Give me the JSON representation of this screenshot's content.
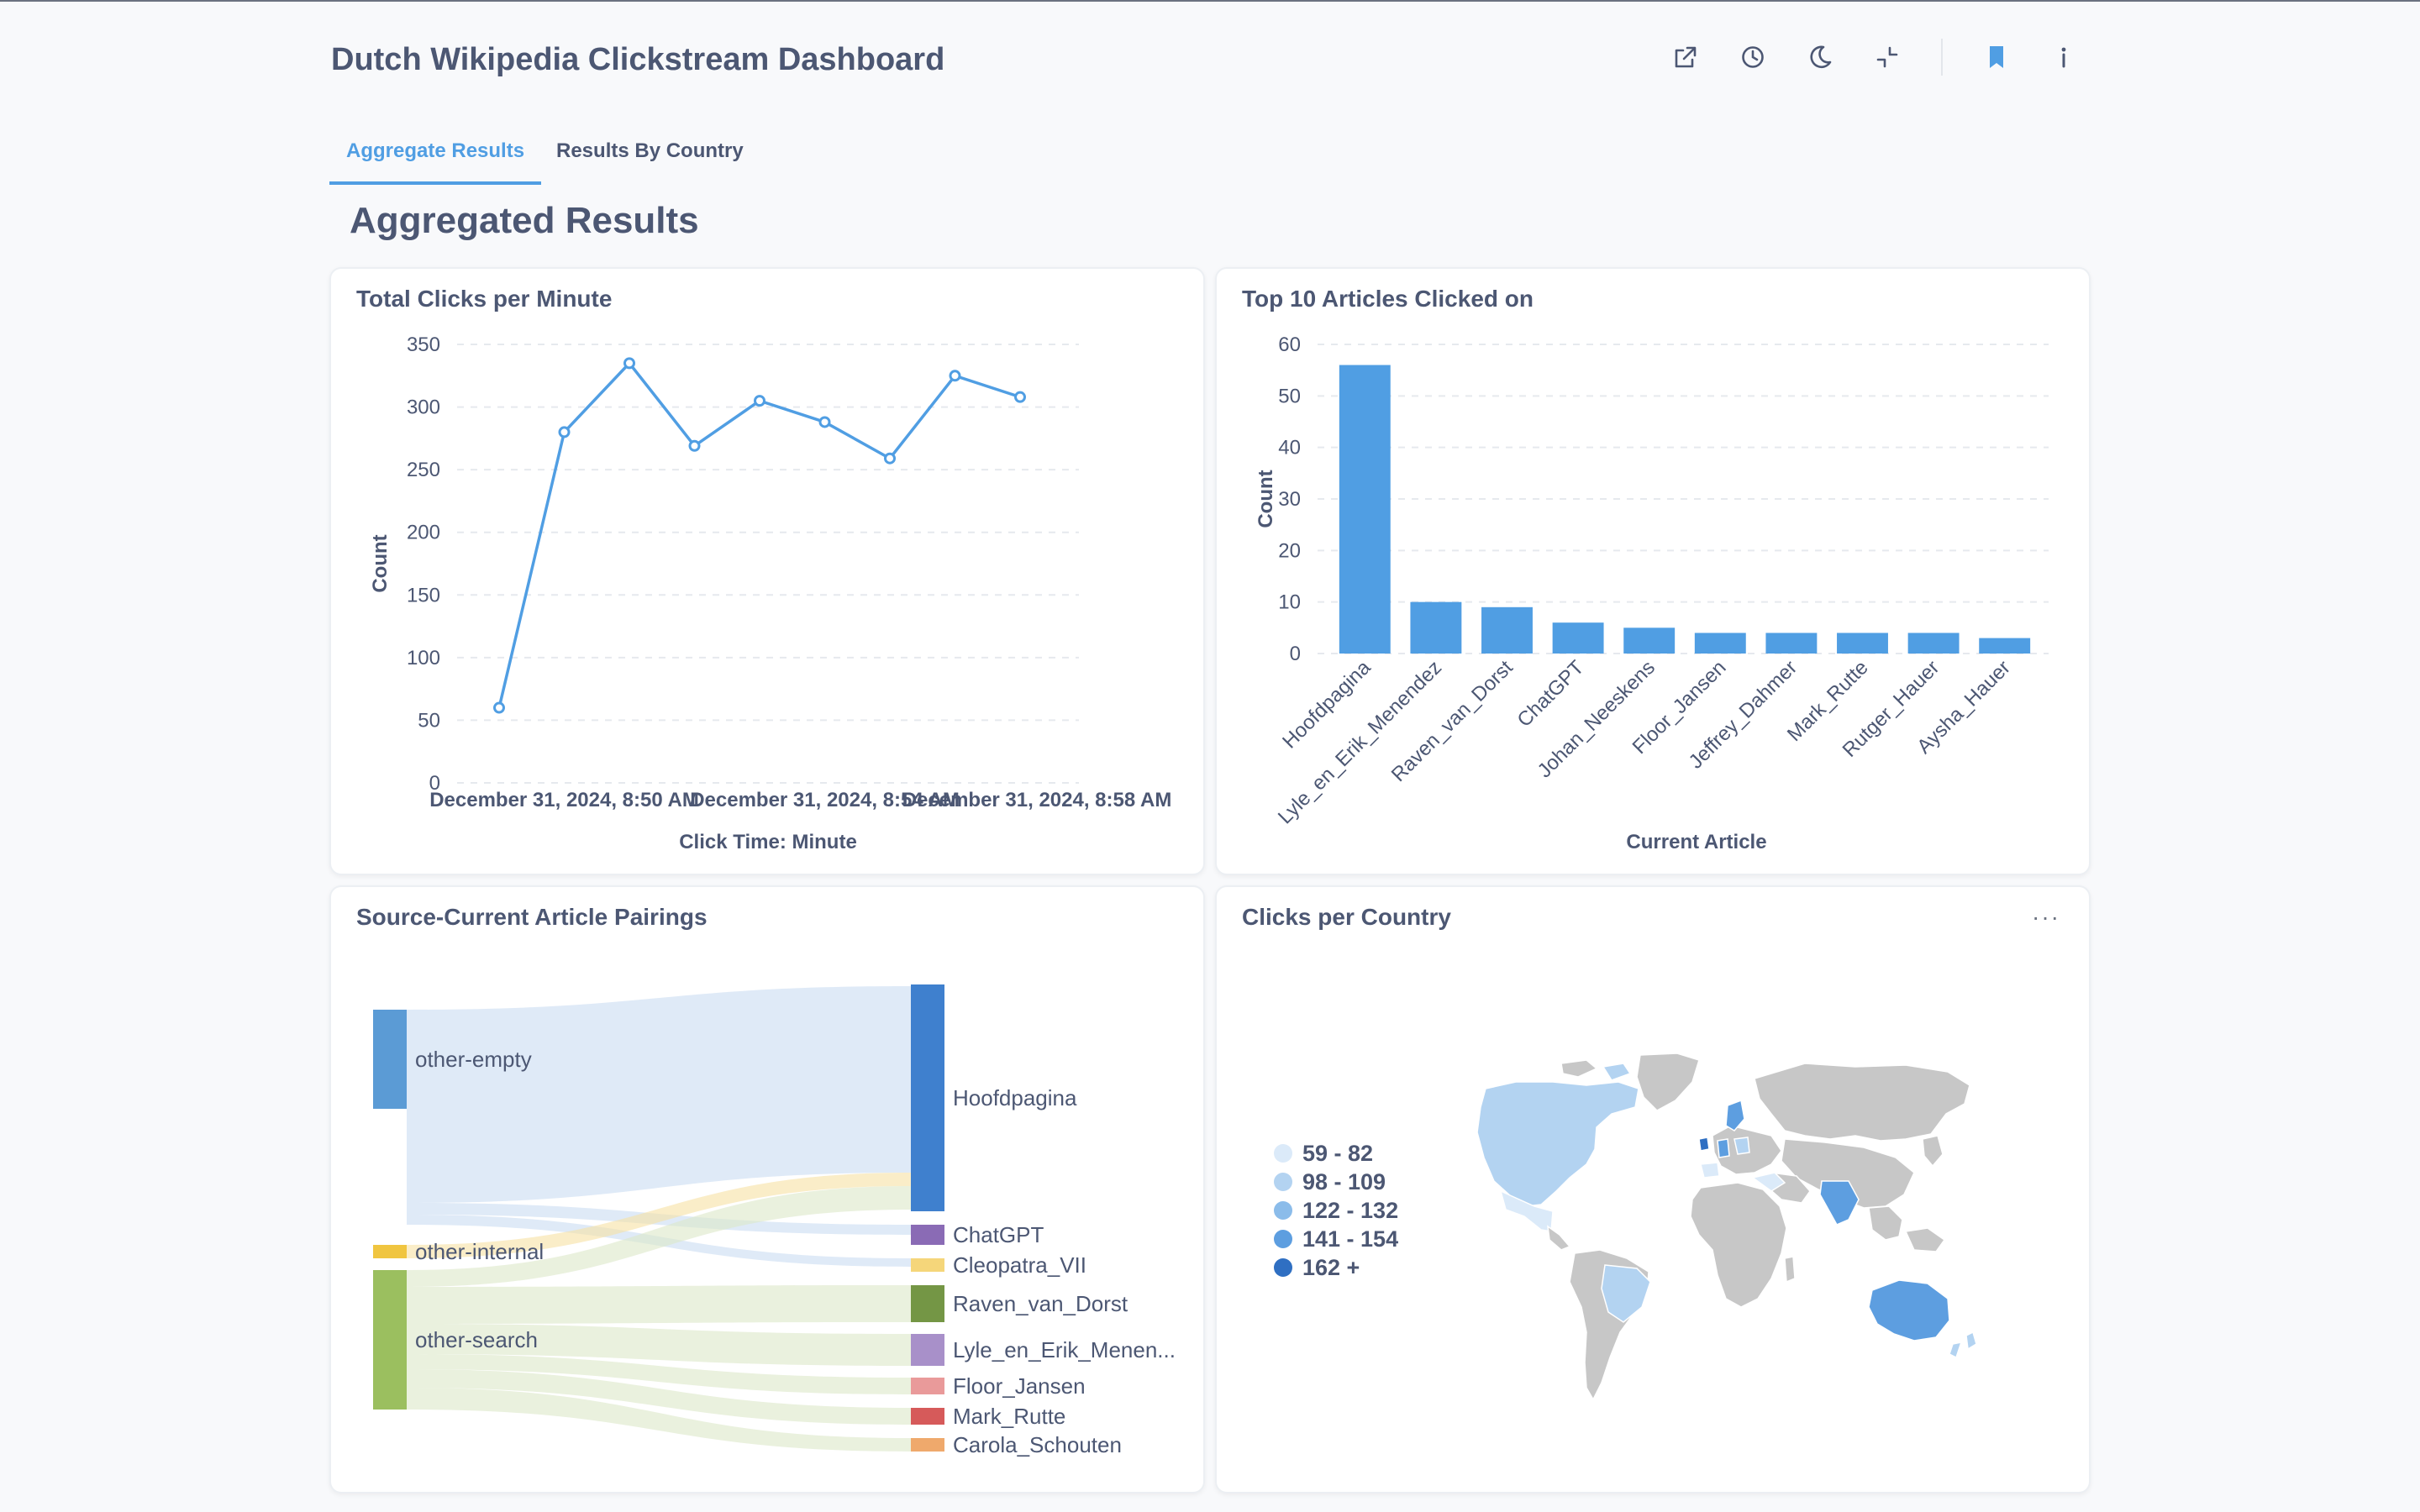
{
  "dashboard": {
    "title": "Dutch Wikipedia Clickstream Dashboard",
    "header_icons": [
      "share-icon",
      "clock-icon",
      "moon-icon",
      "collapse-icon",
      "bookmark-icon",
      "info-icon"
    ],
    "accent_color": "#509ee3"
  },
  "tabs": [
    {
      "label": "Aggregate Results",
      "active": true
    },
    {
      "label": "Results By Country",
      "active": false
    }
  ],
  "section": {
    "heading": "Aggregated Results"
  },
  "cards": {
    "clicks_per_minute": {
      "title": "Total Clicks per Minute"
    },
    "top_articles": {
      "title": "Top 10 Articles Clicked on"
    },
    "pairings": {
      "title": "Source-Current Article Pairings"
    },
    "countries": {
      "title": "Clicks per Country",
      "menu": "···"
    }
  },
  "chart_data": [
    {
      "type": "line",
      "title": "Total Clicks per Minute",
      "xlabel": "Click Time: Minute",
      "ylabel": "Count",
      "x_ticks": [
        "December 31, 2024, 8:50 AM",
        "December 31, 2024, 8:54 AM",
        "December 31, 2024, 8:58 AM"
      ],
      "x": [
        "December 31, 2024, 8:49 AM",
        "December 31, 2024, 8:50 AM",
        "December 31, 2024, 8:51 AM",
        "December 31, 2024, 8:52 AM",
        "December 31, 2024, 8:53 AM",
        "December 31, 2024, 8:54 AM",
        "December 31, 2024, 8:55 AM",
        "December 31, 2024, 8:56 AM",
        "December 31, 2024, 8:57 AM"
      ],
      "values": [
        60,
        280,
        335,
        269,
        305,
        288,
        259,
        325,
        308
      ],
      "ylim": [
        0,
        350
      ],
      "yticks": [
        0,
        50,
        100,
        150,
        200,
        250,
        300,
        350
      ],
      "grid": true,
      "color": "#509ee3"
    },
    {
      "type": "bar",
      "title": "Top 10 Articles Clicked on",
      "xlabel": "Current Article",
      "ylabel": "Count",
      "categories": [
        "Hoofdpagina",
        "Lyle_en_Erik_Menendez",
        "Raven_van_Dorst",
        "ChatGPT",
        "Johan_Neeskens",
        "Floor_Jansen",
        "Jeffrey_Dahmer",
        "Mark_Rutte",
        "Rutger_Hauer",
        "Aysha_Hauer"
      ],
      "values": [
        56,
        10,
        9,
        6,
        5,
        4,
        4,
        4,
        4,
        3
      ],
      "ylim": [
        0,
        60
      ],
      "yticks": [
        0,
        10,
        20,
        30,
        40,
        50,
        60
      ],
      "grid": true,
      "color": "#509ee3"
    },
    {
      "type": "sankey",
      "title": "Source-Current Article Pairings",
      "sources": [
        {
          "name": "other-empty",
          "color": "#5b9bd5"
        },
        {
          "name": "other-internal",
          "color": "#f0c540"
        },
        {
          "name": "other-search",
          "color": "#9bbf5f"
        }
      ],
      "targets": [
        {
          "name": "Hoofdpagina",
          "color": "#3f80ce"
        },
        {
          "name": "ChatGPT",
          "color": "#8a6bb5"
        },
        {
          "name": "Cleopatra_VII",
          "color": "#f5d67a"
        },
        {
          "name": "Raven_van_Dorst",
          "color": "#749645"
        },
        {
          "name": "Lyle_en_Erik_Menen...",
          "color": "#a890c9"
        },
        {
          "name": "Floor_Jansen",
          "color": "#e99a9a"
        },
        {
          "name": "Mark_Rutte",
          "color": "#d65a5a"
        },
        {
          "name": "Carola_Schouten",
          "color": "#efa96c"
        }
      ]
    },
    {
      "type": "map",
      "title": "Clicks per Country",
      "legend": [
        {
          "label": "59 - 82",
          "color": "#dbeaf9"
        },
        {
          "label": "98 - 109",
          "color": "#b3d3f1"
        },
        {
          "label": "122 - 132",
          "color": "#8bbcea"
        },
        {
          "label": "141 - 154",
          "color": "#5d9ee0"
        },
        {
          "label": "162 +",
          "color": "#2f6fc2"
        }
      ]
    }
  ]
}
